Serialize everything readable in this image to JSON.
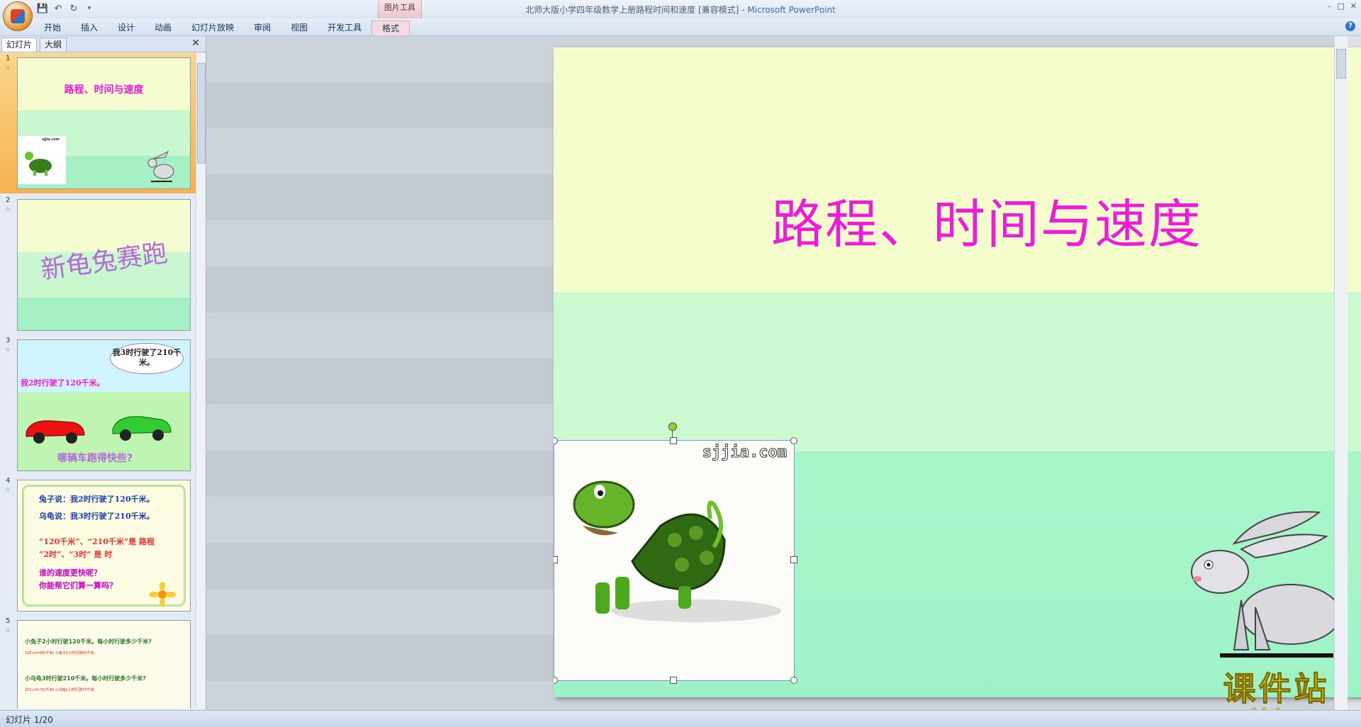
{
  "window": {
    "title": "北师大版小学四年级数学上册路程时间和速度 [兼容模式] - ",
    "app_name": "Microsoft PowerPoint",
    "context_group": "图片工具",
    "controls": [
      "–",
      "□",
      "✕"
    ]
  },
  "ribbon": {
    "tabs": [
      "开始",
      "插入",
      "设计",
      "动画",
      "幻灯片放映",
      "审阅",
      "视图",
      "开发工具",
      "格式"
    ],
    "active_context_tab": "格式",
    "help": "?"
  },
  "left_pane": {
    "tabs": [
      "幻灯片",
      "大纲"
    ],
    "close": "✕",
    "thumbnails": [
      {
        "num": "1",
        "title": "路程、时间与速度",
        "logo": "sjjia.com"
      },
      {
        "num": "2",
        "title": "新龟兔赛跑"
      },
      {
        "num": "3",
        "bubble": "我3时行驶了210千米。",
        "line1": "我2时行驶了120千米。",
        "question": "哪辆车跑得快些?"
      },
      {
        "num": "4",
        "lines": [
          "兔子说：我2时行驶了120千米。",
          "乌龟说：我3时行驶了210千米。",
          "“120千米”、“210千米”是 路程",
          "“2时”、“3时” 是 时",
          "谁的速度更快呢？",
          "你能帮它们算一算吗？"
        ]
      },
      {
        "num": "5",
        "lines": [
          "小兔子2小时行驶120千米。每小时行驶多少千米?",
          "120÷2=60(千米)  小兔子1小时行驶60千米。",
          "小乌龟3时行驶210千米。每小时行驶多少千米?",
          "210÷3=70(千米)  小乌龟1小时行驶70千米。"
        ]
      }
    ]
  },
  "slide": {
    "title": "路程、时间与速度",
    "photo_watermark": "sjjia.com"
  },
  "status": {
    "text": "幻灯片 1/20"
  },
  "overlay_logo": {
    "big": "课件站",
    "url": "www.kjzhan.com"
  },
  "colors": {
    "title_magenta": "#ef1bd9",
    "slide_top": "#f5fdcd",
    "slide_mid": "#ccf9cf",
    "slide_bottom": "#9ef3c6",
    "logo_yellow": "#f6e000"
  }
}
